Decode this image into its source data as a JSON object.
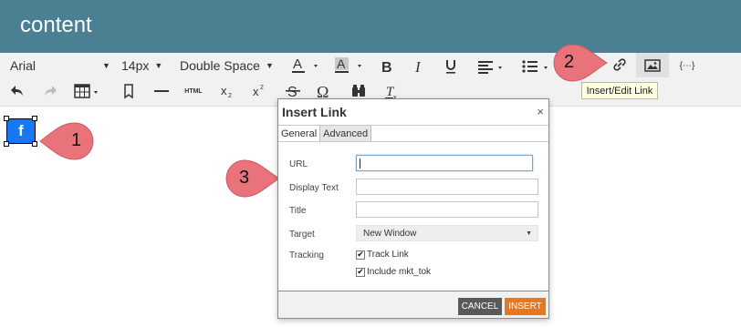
{
  "header": {
    "title": "content"
  },
  "toolbar": {
    "font_family": "Arial",
    "font_size": "14px",
    "line_spacing": "Double Space",
    "icons": [
      "font-color-icon",
      "highlight-color-icon",
      "bold-icon",
      "italic-icon",
      "underline-icon",
      "align-icon",
      "list-icon",
      "link-icon",
      "image-icon",
      "merge-tag-icon",
      "undo-icon",
      "redo-icon",
      "table-icon",
      "bookmark-icon",
      "horizontal-line-icon",
      "html-icon",
      "subscript-icon",
      "superscript-icon",
      "strikethrough-icon",
      "special-char-icon",
      "find-icon",
      "clear-format-icon"
    ],
    "html_label": "HTML",
    "merge_label": "{⋯}",
    "tooltip": "Insert/Edit Link"
  },
  "callouts": [
    {
      "label": "1",
      "color": "#e8737b"
    },
    {
      "label": "2",
      "color": "#e8737b"
    },
    {
      "label": "3",
      "color": "#e8737b"
    }
  ],
  "content": {
    "image_icon": "facebook-logo-icon",
    "image_text": "f"
  },
  "dialog": {
    "title": "Insert Link",
    "close": "×",
    "tabs": [
      {
        "label": "General",
        "active": true
      },
      {
        "label": "Advanced",
        "active": false
      }
    ],
    "fields": {
      "url_label": "URL",
      "url_value": "",
      "display_text_label": "Display Text",
      "display_text_value": "",
      "title_label": "Title",
      "title_value": "",
      "target_label": "Target",
      "target_value": "New Window",
      "tracking_label": "Tracking",
      "track_link_label": "Track Link",
      "track_link_checked": true,
      "include_mkt_tok_label": "Include mkt_tok",
      "include_mkt_tok_checked": true
    },
    "buttons": {
      "cancel": "CANCEL",
      "insert": "INSERT"
    },
    "colors": {
      "insert": "#e87722",
      "cancel": "#595959"
    }
  },
  "colors": {
    "header_bg": "#4a8091",
    "callout": "#e8737b",
    "facebook_blue": "#1877f2"
  }
}
